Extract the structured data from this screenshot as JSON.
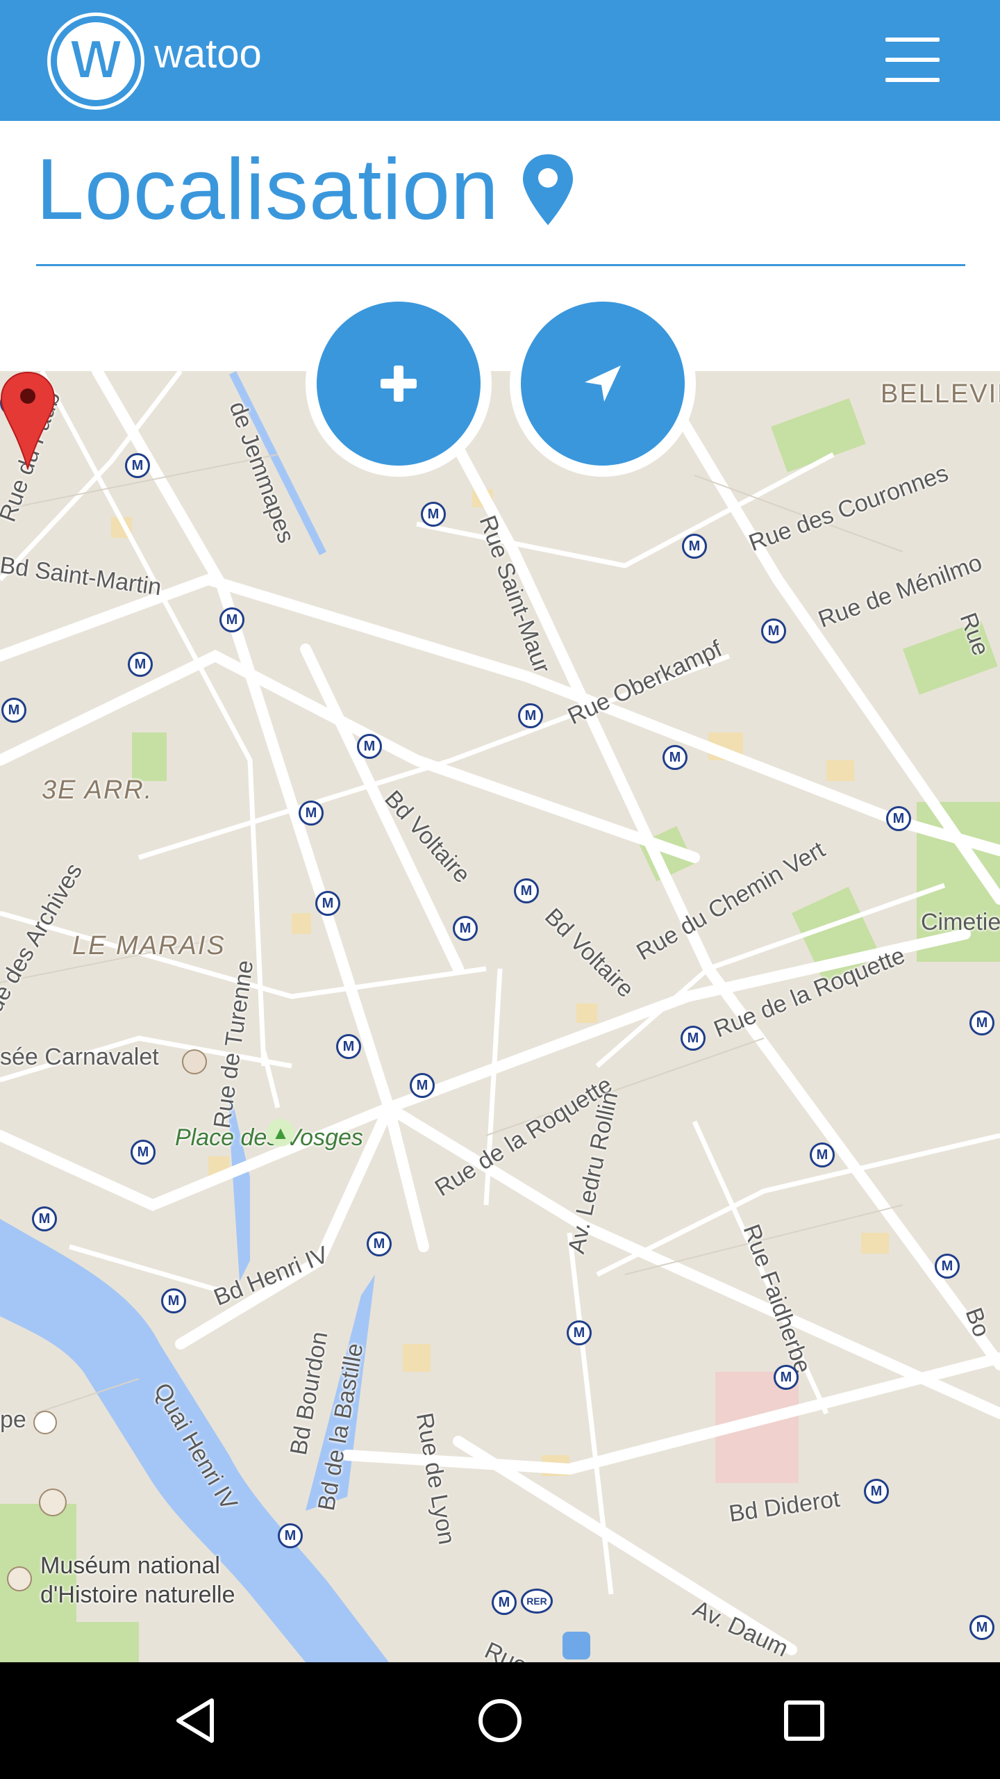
{
  "header": {
    "app_name": "watoo",
    "logo_letter": "W",
    "menu_icon": "hamburger-icon"
  },
  "page": {
    "title": "Localisation",
    "title_icon": "map-marker-icon"
  },
  "actions": {
    "add_icon": "plus-icon",
    "locate_icon": "navigation-arrow-icon"
  },
  "map": {
    "metro_symbol": "M",
    "labels": {
      "belleville": "BELLEVIL",
      "rue_faub": "Rue du Faub",
      "de_jemmapes": "de Jemmapes",
      "bd_saint_martin": "Bd Saint-Martin",
      "rue_des_couronnes": "Rue des Couronnes",
      "rue_saint_maur": "Rue Saint-Maur",
      "rue_de_menilmo": "Rue de Ménilmo",
      "rue_oberkampf": "Rue Oberkampf",
      "rue_edge": "Rue",
      "arr3": "3E ARR.",
      "bd_voltaire_1": "Bd Voltaire",
      "rue_du_chemin_vert": "Rue du Chemin Vert",
      "cimetiere": "Cimetie",
      "rue_des_archives": "ue des Archives",
      "le_marais": "LE MARAIS",
      "bd_voltaire_2": "Bd Voltaire",
      "rue_de_la_roquette_1": "Rue de la Roquette",
      "rue_de_turenne": "Rue de Turenne",
      "musee_carnavalet": "sée Carnavalet",
      "place_des_vosges": "Place des Vosges",
      "rue_de_la_roquette_2": "Rue de la Roquette",
      "av_ledru_rollin": "Av. Ledru Rollin",
      "rue_faidherbe": "Rue Faidherbe",
      "bd_henri_iv": "Bd Henri IV",
      "bo_edge": "Bo",
      "quai_henri_iv": "Quai Henri IV",
      "bd_bourdon": "Bd Bourdon",
      "bd_de_la_bastille": "Bd de la Bastille",
      "rue_de_lyon": "Rue de Lyon",
      "pe_edge": "pe",
      "bd_diderot": "Bd Diderot",
      "museum_1": "Muséum national",
      "museum_2": "d'Histoire naturelle",
      "av_daumesnil": "Av. Daum",
      "rue_bottom": "Rue",
      "rer": "RER"
    }
  },
  "colors": {
    "primary": "#3a97dc",
    "map_bg": "#e8e3d8",
    "water": "#a4c6f6",
    "park": "#c6dfa3",
    "pin": "#e53935"
  },
  "system_nav": {
    "back_icon": "back-triangle-icon",
    "home_icon": "home-circle-icon",
    "recents_icon": "recents-square-icon"
  }
}
